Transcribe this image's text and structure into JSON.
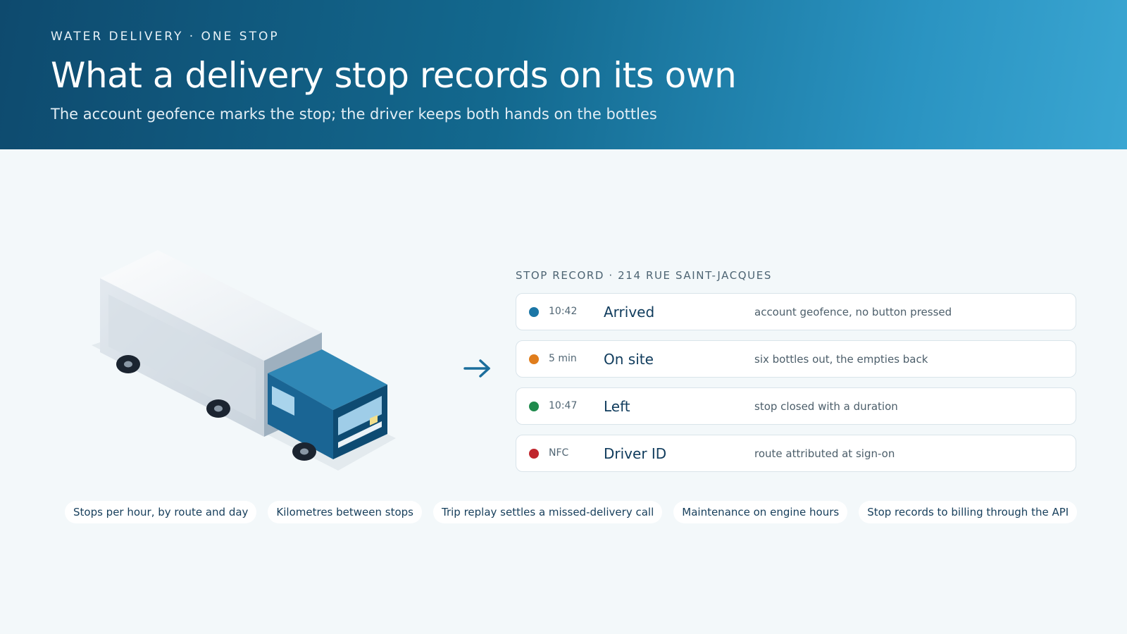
{
  "header": {
    "eyebrow": "WATER  DELIVERY · ONE STOP",
    "title": "What a delivery stop records on its own",
    "subtitle": "The account geofence marks the stop; the driver keeps both hands on the bottles"
  },
  "record": {
    "label": "STOP RECORD · 214 RUE SAINT-JACQUES",
    "rows": [
      {
        "time": "10:42",
        "state": "Arrived",
        "note": "account geofence, no button pressed",
        "color": "#1b76a6"
      },
      {
        "time": "5 min",
        "state": "On site",
        "note": "six bottles out, the empties back",
        "color": "#e07d1c"
      },
      {
        "time": "10:47",
        "state": "Left",
        "note": "stop closed with a duration",
        "color": "#1f8a4c"
      },
      {
        "time": "NFC",
        "state": "Driver ID",
        "note": "route attributed at sign-on",
        "color": "#c0262d"
      }
    ]
  },
  "chips": [
    "Stops per hour, by route and day",
    "Kilometres between stops",
    "Trip replay settles a missed-delivery call",
    "Maintenance on engine hours",
    "Stop records to billing through the API"
  ],
  "icons": {
    "truck": "delivery-truck-illustration",
    "arrow": "arrow-right-icon"
  }
}
